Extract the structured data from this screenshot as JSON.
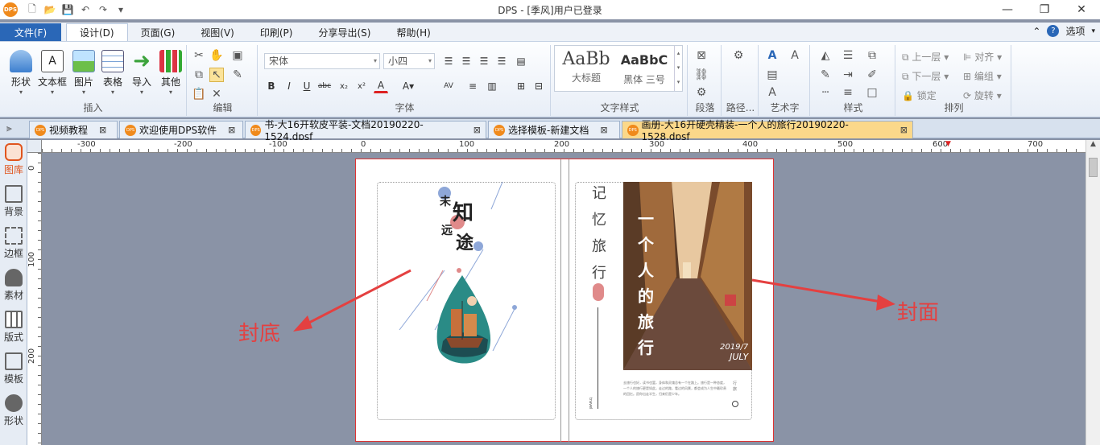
{
  "titlebar": {
    "logo": "DPS",
    "title": "DPS - [季风]用户已登录",
    "minimize": "—",
    "restore": "❐",
    "close": "✕"
  },
  "menu": {
    "file": "文件(F)",
    "tabs": [
      "设计(D)",
      "页面(G)",
      "视图(V)",
      "印刷(P)",
      "分享导出(S)",
      "帮助(H)"
    ],
    "options": "选项"
  },
  "ribbon": {
    "insert": {
      "label": "插入",
      "buttons": [
        "形状",
        "文本框",
        "图片",
        "表格",
        "导入",
        "其他"
      ]
    },
    "edit": {
      "label": "编辑"
    },
    "font": {
      "label": "字体",
      "font_name": "宋体",
      "font_size": "小四"
    },
    "textstyle": {
      "label": "文字样式",
      "items": [
        {
          "preview": "AaBb",
          "name": "大标题"
        },
        {
          "preview": "AaBbC",
          "name": "黑体 三号"
        }
      ]
    },
    "paragraph": {
      "label": "段落"
    },
    "path": {
      "label": "路径..."
    },
    "arttext": {
      "label": "艺术字"
    },
    "style": {
      "label": "样式"
    },
    "arrange": {
      "label": "排列",
      "items": [
        "上一层",
        "对齐",
        "下一层",
        "编组",
        "锁定",
        "旋转"
      ]
    }
  },
  "doctabs": [
    "视频教程",
    "欢迎使用DPS软件",
    "书-大16开软皮平装-文档20190220-1524.dpsf",
    "选择模板-新建文档",
    "画册-大16开硬壳精装-一个人的旅行20190220-1528.dpsf"
  ],
  "sidebar": [
    "图库",
    "背景",
    "边框",
    "素材",
    "版式",
    "模板",
    "形状"
  ],
  "ruler": {
    "h": [
      "-300",
      "-200",
      "-100",
      "0",
      "100",
      "200",
      "300",
      "400",
      "500",
      "600",
      "700"
    ],
    "v": [
      "0",
      "100",
      "200"
    ]
  },
  "canvas": {
    "back_cover_title": {
      "c1": "未",
      "c2": "知",
      "c3": "远",
      "c4": "途"
    },
    "spine_text": "记忆旅行",
    "cover_title": "一个人的旅行",
    "cover_date": "2019/7",
    "cover_month": "JULY",
    "back_side_small": "行旅",
    "body_text": "去旅行也好，读书也罢，身体和灵魂总有一个在路上。旅行是一种态度，一个人的旅行更是如此，走过的路，看过的风景，都会成为人生中最珍贵的回忆。愿你出走半生，归来仍是少年。",
    "travel_vertical": "travel"
  },
  "annotations": {
    "back": "封底",
    "front": "封面"
  },
  "colors": {
    "accent": "#2a67b7",
    "active_tab": "#fbd88a",
    "annotation": "#e44040",
    "dps_orange": "#f08a1c"
  }
}
